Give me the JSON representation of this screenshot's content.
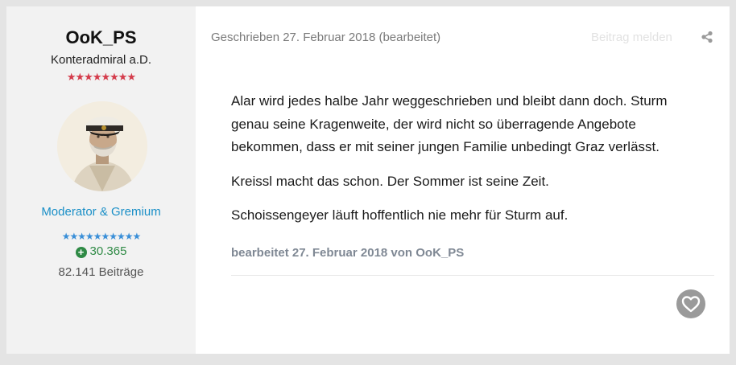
{
  "author": {
    "username": "OoK_PS",
    "rank_title": "Konteradmiral a.D.",
    "rank_stars": "★★★★★★★★",
    "group": "Moderator & Gremium",
    "group_stars": "★★★★★★★★★★",
    "reputation": "30.365",
    "post_count": "82.141 Beiträge"
  },
  "post": {
    "meta": "Geschrieben 27. Februar 2018 (bearbeitet)",
    "report_label": "Beitrag melden",
    "paragraphs": [
      "Alar wird jedes halbe Jahr weggeschrieben und bleibt dann doch. Sturm genau seine Kragenweite, der wird nicht so überragende Angebote bekommen, dass er mit seiner jungen Familie unbedingt Graz verlässt.",
      "Kreissl macht das schon. Der Sommer ist seine Zeit.",
      "Schoissengeyer läuft hoffentlich nie mehr für Sturm auf."
    ],
    "edited_note": "bearbeitet 27. Februar 2018 von OoK_PS"
  },
  "icons": {
    "share": "share-icon",
    "like": "heart-icon",
    "reputation": "plus-circle-icon"
  },
  "colors": {
    "group": "#1a8fc7",
    "reputation": "#2f8a45",
    "rank_stars": "#d43b4b",
    "group_stars": "#3a8fd8"
  }
}
